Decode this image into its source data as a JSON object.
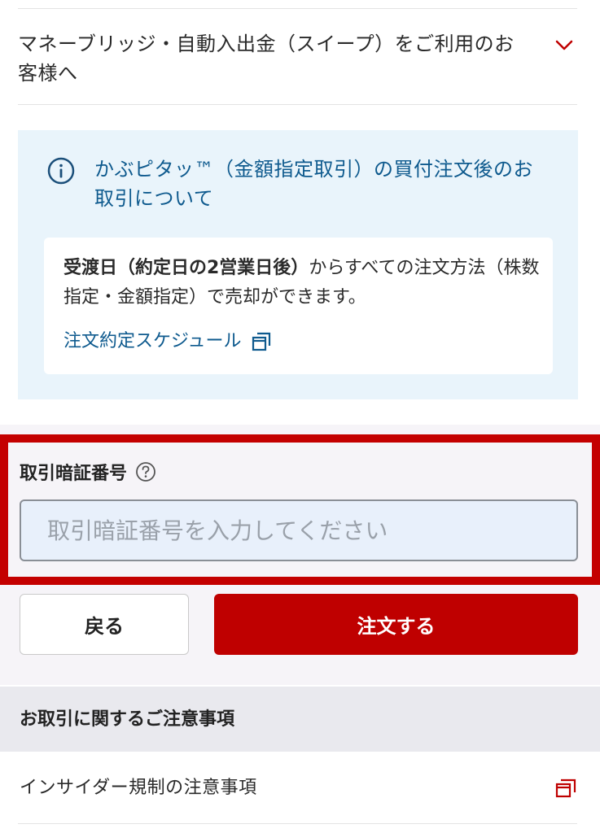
{
  "accordion": {
    "label": "マネーブリッジ・自動入出金（スイープ）をご利用のお客様へ",
    "icon": "chevron-down-icon"
  },
  "info": {
    "title": "かぶピタッ™（金額指定取引）の買付注文後のお取引について",
    "card_bold": "受渡日（約定日の2営業日後）",
    "card_text": "からすべての注文方法（株数指定・金額指定）で売却ができます。",
    "schedule_link": "注文約定スケジュール"
  },
  "pin": {
    "label": "取引暗証番号",
    "placeholder": "取引暗証番号を入力してください",
    "value": ""
  },
  "buttons": {
    "back": "戻る",
    "order": "注文する"
  },
  "notice": {
    "title": "お取引に関するご注意事項",
    "insider_link": "インサイダー規制の注意事項"
  },
  "colors": {
    "brand_red": "#bf0000",
    "highlight_red": "#c40000",
    "link_blue": "#0e5a8e",
    "info_bg": "#e9f4fb",
    "input_bg": "#e8f0fb"
  }
}
